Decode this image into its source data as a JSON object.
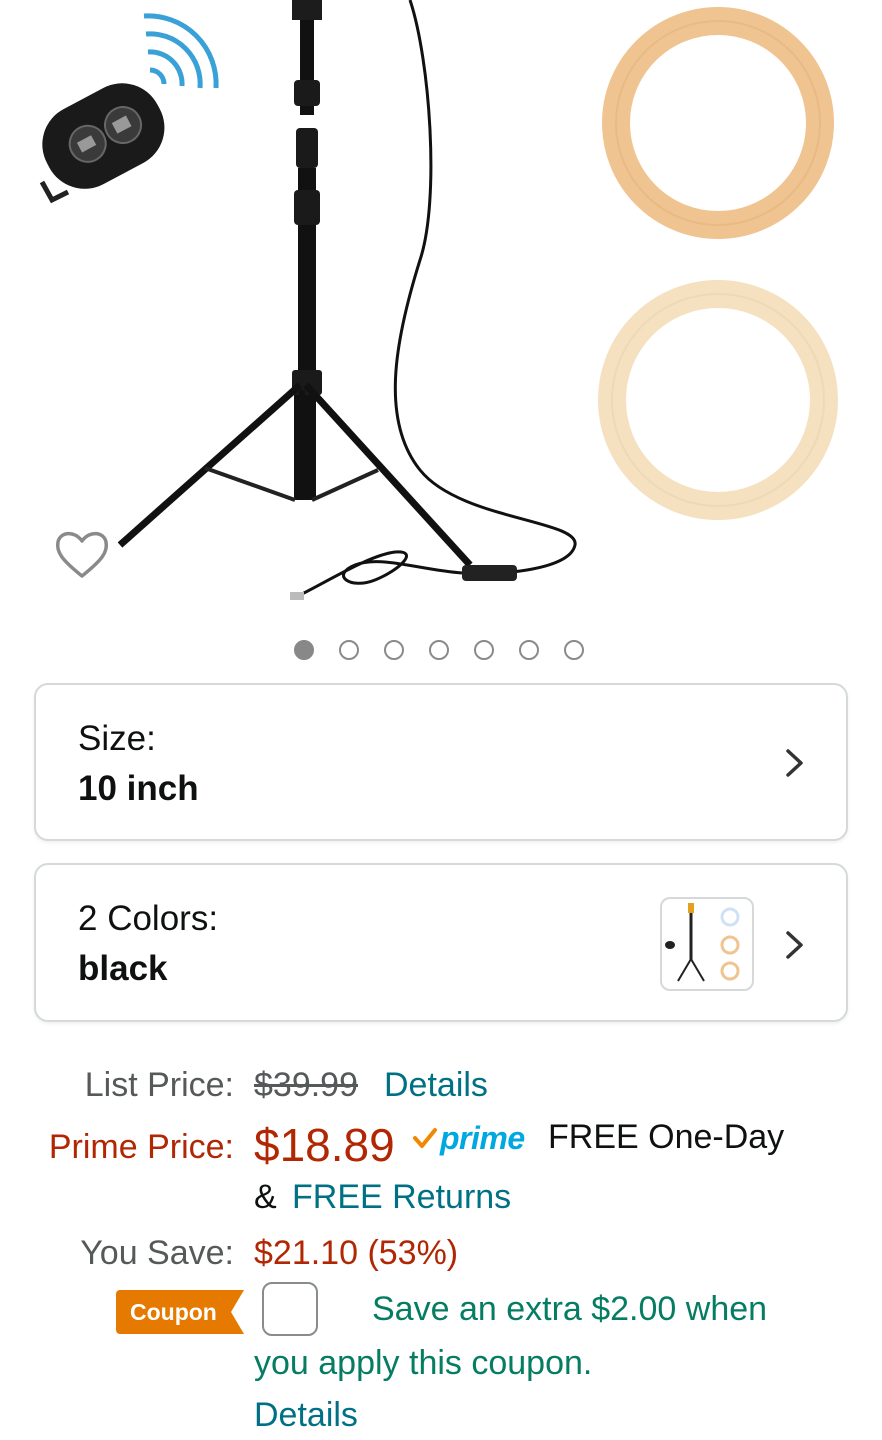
{
  "gallery": {
    "wishlist_icon": "heart-outline-icon",
    "dot_count": 7,
    "active_dot": 0
  },
  "size": {
    "label": "Size:",
    "value": "10 inch"
  },
  "color": {
    "label": "2 Colors:",
    "value": "black"
  },
  "pricing": {
    "list_price_label": "List Price:",
    "list_price": "$39.99",
    "list_price_details": "Details",
    "prime_price_label": "Prime Price:",
    "prime_price": "$18.89",
    "prime_badge": "prime",
    "free_one_day": "FREE One-Day",
    "ampersand": "&",
    "free_returns": "FREE Returns",
    "you_save_label": "You Save:",
    "you_save": "$21.10 (53%)"
  },
  "coupon": {
    "badge": "Coupon",
    "text_line1": "Save an extra $2.00 when",
    "text_line2": "you apply this coupon.",
    "details": "Details"
  },
  "colors": {
    "price_red": "#b12704",
    "link_teal": "#007185",
    "coupon_green": "#067d62",
    "coupon_orange": "#e67a00",
    "prime_blue": "#00a8e1"
  }
}
